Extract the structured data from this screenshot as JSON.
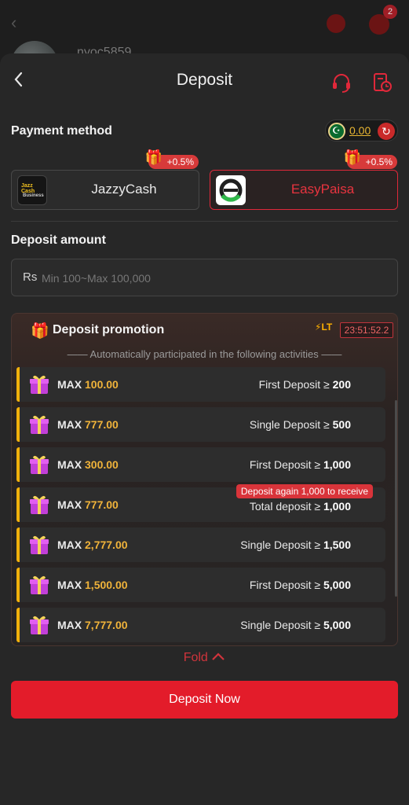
{
  "background": {
    "username": "nyoc5859",
    "notification_count": "2"
  },
  "header": {
    "title": "Deposit",
    "back_icon": "chevron-left-icon",
    "support_icon": "headset-icon",
    "history_icon": "clock-history-icon"
  },
  "payment": {
    "section_label": "Payment method",
    "balance": "0.00",
    "methods": [
      {
        "name": "JazzyCash",
        "bonus": "+0.5%",
        "selected": false
      },
      {
        "name": "EasyPaisa",
        "bonus": "+0.5%",
        "selected": true
      }
    ]
  },
  "amount": {
    "section_label": "Deposit amount",
    "currency": "Rs",
    "placeholder": "Min 100~Max 100,000"
  },
  "promotion": {
    "title": "Deposit promotion",
    "badge": "LT",
    "timer": "23:51:52.2",
    "subtitle": "Automatically participated in the following activities",
    "rows": [
      {
        "max_label": "MAX",
        "max_value": "100.00",
        "condition": "First Deposit ≥",
        "amount": "200"
      },
      {
        "max_label": "MAX",
        "max_value": "777.00",
        "condition": "Single Deposit ≥",
        "amount": "500"
      },
      {
        "max_label": "MAX",
        "max_value": "300.00",
        "condition": "First Deposit ≥",
        "amount": "1,000"
      },
      {
        "max_label": "MAX",
        "max_value": "777.00",
        "condition": "Total deposit ≥",
        "amount": "1,000",
        "note": "Deposit again 1,000 to receive"
      },
      {
        "max_label": "MAX",
        "max_value": "2,777.00",
        "condition": "Single Deposit ≥",
        "amount": "1,500"
      },
      {
        "max_label": "MAX",
        "max_value": "1,500.00",
        "condition": "First Deposit ≥",
        "amount": "5,000"
      },
      {
        "max_label": "MAX",
        "max_value": "7,777.00",
        "condition": "Single Deposit ≥",
        "amount": "5,000"
      }
    ]
  },
  "fold_label": "Fold",
  "submit_label": "Deposit Now",
  "colors": {
    "accent": "#e31c2a",
    "gold": "#f0b33a",
    "background": "#272727"
  }
}
